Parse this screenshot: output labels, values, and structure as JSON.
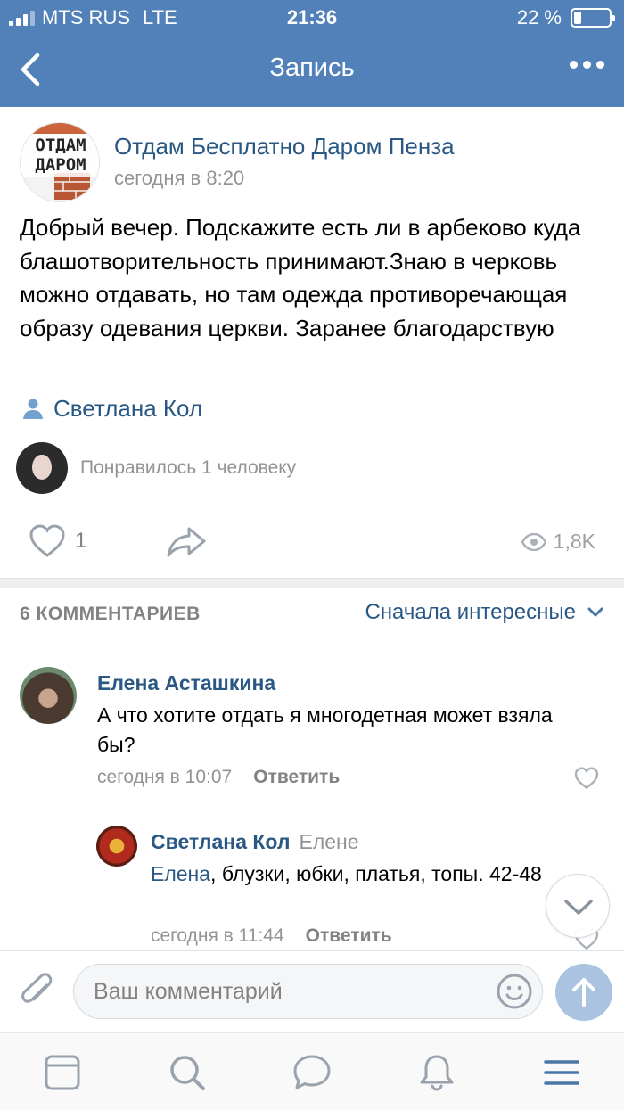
{
  "status_bar": {
    "carrier": "MTS RUS",
    "network": "LTE",
    "time": "21:36",
    "battery_text": "22 %",
    "battery_level": 0.22
  },
  "nav": {
    "title": "Запись",
    "back_icon": "chevron-left-icon",
    "more_icon": "more-dots-icon"
  },
  "post": {
    "community_name": "Отдам Бесплатно Даром Пенза",
    "community_logo_text": "ОТДАМ\nДАРОМ",
    "time": "сегодня в 8:20",
    "text": "Добрый вечер. Подскажите есть ли в арбеково куда блашотворительность принимают.Знаю в черковь можно отдавать, но там одежда противоречающая образу одевания церкви. Заранее благодарствую",
    "author": "Светлана Кол",
    "likes_text": "Понравилось 1 человеку",
    "like_count": "1",
    "views": "1,8K"
  },
  "comments_section": {
    "count_label": "6 КОММЕНТАРИЕВ",
    "sort_label": "Сначала интересные",
    "comments": [
      {
        "author": "Елена Асташкина",
        "text": "А что хотите отдать я многодетная может взяла бы?",
        "time": "сегодня в 10:07",
        "reply_label": "Ответить"
      },
      {
        "author": "Светлана Кол",
        "reply_to": "Елене",
        "mention": "Елена",
        "text": ", блузки, юбки, платья, топы. 42-48",
        "time": "сегодня в 11:44",
        "reply_label": "Ответить"
      }
    ]
  },
  "composer": {
    "placeholder": "Ваш комментарий"
  },
  "tabbar": {
    "items": [
      "news-icon",
      "search-icon",
      "messages-icon",
      "notifications-icon",
      "menu-icon"
    ]
  },
  "colors": {
    "header": "#5181b8",
    "link": "#2a5885",
    "secondary_text": "#939393",
    "icon_blue": "#4a76a8",
    "send_disabled": "#a9c3e0"
  }
}
